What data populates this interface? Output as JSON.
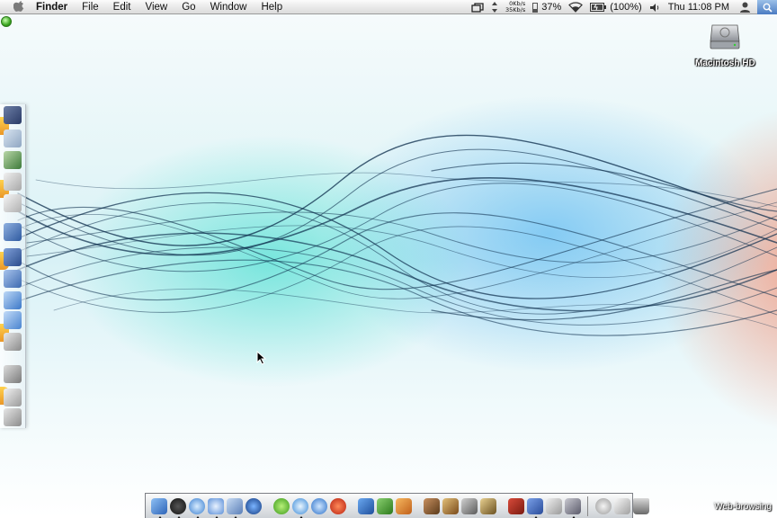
{
  "menubar": {
    "app_name": "Finder",
    "menus": [
      "File",
      "Edit",
      "View",
      "Go",
      "Window",
      "Help"
    ],
    "status": {
      "net_down": "0Kb/s",
      "net_up": "35Kb/s",
      "cpu": "37%",
      "battery": "(100%)",
      "clock": "Thu 11:08 PM"
    }
  },
  "desktop": {
    "disk_label": "Macintosh HD",
    "watermark": "Web-browsing"
  },
  "dock": {
    "item_icons": [
      "finder-icon",
      "dashboard-icon",
      "safari-icon",
      "network-icon",
      "mail-icon",
      "google-earth-icon",
      "messenger-icon",
      "itunes-icon",
      "quicktime-icon",
      "mercury-icon",
      "word-icon",
      "excel-icon",
      "powerpoint-icon",
      "tools-icon",
      "editor-icon",
      "sword-icon",
      "shield-icon",
      "dictionary-icon",
      "xcode-icon",
      "bootcamp-icon",
      "system-preferences-icon",
      "downloads-icon",
      "documents-icon",
      "trash-icon"
    ]
  },
  "colors": {
    "menubar": "#e8e8e8",
    "wave_dark": "#0b2b4a",
    "wallpaper_teal": "#28dcc8",
    "wallpaper_blue": "#3caaf0",
    "wallpaper_coral": "#fa8c6e"
  }
}
